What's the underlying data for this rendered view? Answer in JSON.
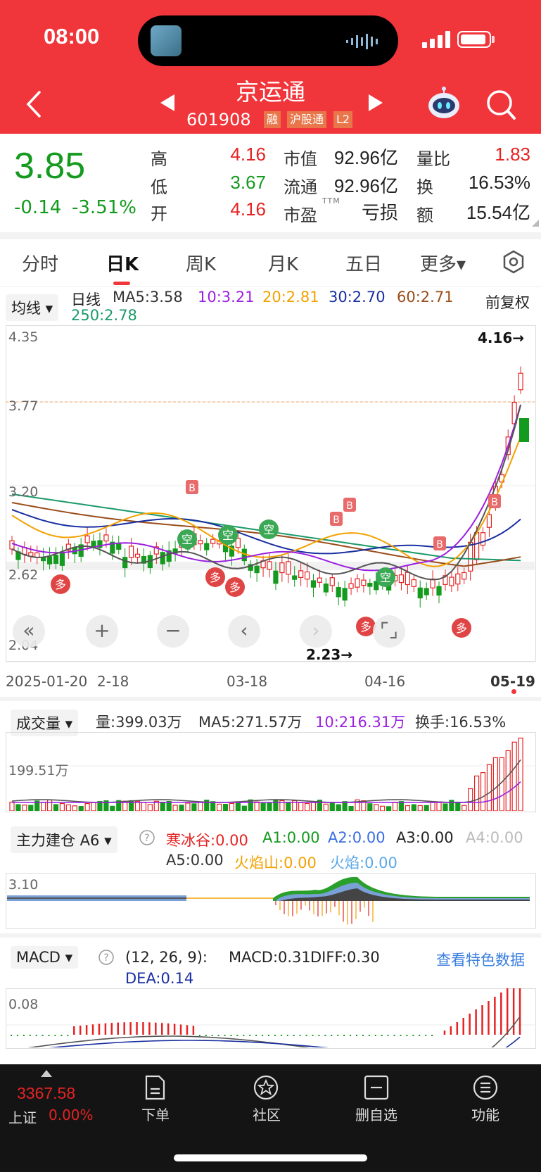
{
  "status": {
    "time": "08:00"
  },
  "header": {
    "stock_name": "京运通",
    "stock_code": "601908",
    "tags": [
      "融",
      "沪股通",
      "L2"
    ]
  },
  "quote": {
    "price": "3.85",
    "change": "-0.14",
    "change_pct": "-3.51%",
    "col1": [
      {
        "label": "高",
        "value": "4.16"
      },
      {
        "label": "低",
        "value": "3.67"
      },
      {
        "label": "开",
        "value": "4.16"
      }
    ],
    "col2": [
      {
        "label": "市值",
        "value": "92.96亿"
      },
      {
        "label": "流通",
        "value": "92.96亿"
      },
      {
        "label": "市盈",
        "sup": "TTM",
        "value": "亏损"
      }
    ],
    "col3": [
      {
        "label": "量比",
        "value": "1.83"
      },
      {
        "label": "换",
        "value": "16.53%"
      },
      {
        "label": "额",
        "value": "15.54亿"
      }
    ]
  },
  "tabs": [
    "分时",
    "日K",
    "周K",
    "月K",
    "五日",
    "更多▾"
  ],
  "ma_legend": {
    "dropdown": "均线",
    "period": "日线",
    "ma5": "MA5:3.58",
    "ma10": "10:3.21",
    "ma20": "20:2.81",
    "ma30": "30:2.70",
    "ma60": "60:2.71",
    "ma250": "250:2.78",
    "adjust": "前复权"
  },
  "kchart": {
    "y_labels": [
      "4.35",
      "3.77",
      "3.20",
      "2.62",
      "2.04"
    ],
    "high_marker": "4.16→",
    "low_marker": "2.23→",
    "dates": [
      "2025-01-20",
      "2-18",
      "03-18",
      "04-16",
      "05-19"
    ]
  },
  "volume": {
    "dropdown": "成交量",
    "vol": "量:399.03万",
    "ma5": "MA5:271.57万",
    "ma10": "10:216.31万",
    "turnover": "换手:16.53%",
    "y_label": "199.51万"
  },
  "indicator": {
    "dropdown": "主力建仓 A6",
    "a": "寒冰谷:0.00",
    "b": "A1:0.00",
    "c": "A2:0.00",
    "d": "A3:0.00",
    "e": "A4:0.00",
    "f": "A5:0.00",
    "g": "火焰山:0.00",
    "h": "火焰:0.00",
    "y_label": "3.10"
  },
  "macd": {
    "dropdown": "MACD",
    "params": "(12, 26, 9):",
    "macd": "MACD:0.31",
    "diff": "DIFF:0.30",
    "dea": "DEA:0.14",
    "link": "查看特色数据",
    "y_label": "0.08"
  },
  "bottom": {
    "index_value": "3367.58",
    "index_name": "上证",
    "index_pct": "0.00%",
    "items": [
      "下单",
      "社区",
      "删自选",
      "功能"
    ]
  },
  "colors": {
    "header": "#f0353b",
    "up": "#e52323",
    "down": "#149a1e"
  }
}
